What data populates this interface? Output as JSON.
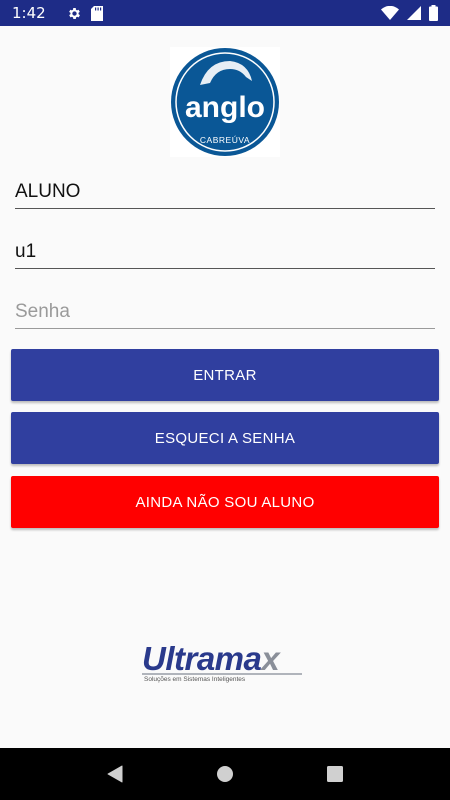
{
  "status_bar": {
    "time": "1:42",
    "icons": [
      "gear-icon",
      "sd-card-icon",
      "wifi-icon",
      "cell-signal-icon",
      "battery-icon"
    ]
  },
  "logo": {
    "brand": "anglo",
    "city": "CABREÚVA",
    "color": "#0a5796"
  },
  "form": {
    "user_type": {
      "value": "ALUNO",
      "placeholder": ""
    },
    "user_id": {
      "value": "u1",
      "placeholder": ""
    },
    "password": {
      "value": "",
      "placeholder": "Senha"
    }
  },
  "buttons": {
    "enter": "ENTRAR",
    "forgot": "ESQUECI A SENHA",
    "not_student": "AINDA NÃO SOU ALUNO"
  },
  "footer": {
    "brand_main": "Ultrama",
    "brand_x": "x",
    "tagline": "Soluções em Sistemas Inteligentes"
  },
  "colors": {
    "status_bar": "#1e2c87",
    "primary_button": "#303f9f",
    "danger_button": "#ff0000",
    "nav_bar": "#000000"
  },
  "nav_bar": {
    "icons": [
      "back-icon",
      "home-icon",
      "recents-icon"
    ]
  }
}
